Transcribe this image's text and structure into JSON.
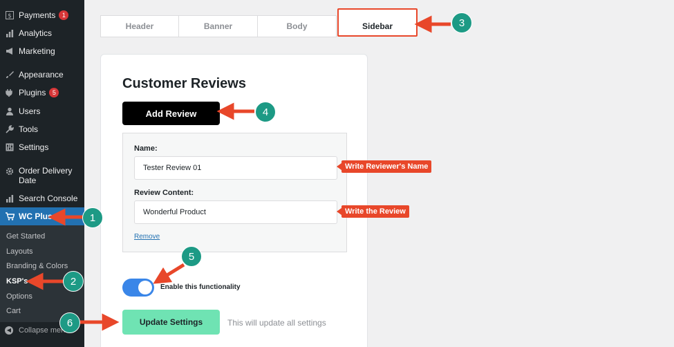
{
  "sidebar": {
    "items": [
      {
        "label": "Payments",
        "icon": "dollar-icon",
        "badge": "1"
      },
      {
        "label": "Analytics",
        "icon": "bar-chart-icon"
      },
      {
        "label": "Marketing",
        "icon": "megaphone-icon"
      },
      {
        "label": "Appearance",
        "icon": "brush-icon"
      },
      {
        "label": "Plugins",
        "icon": "plug-icon",
        "badge": "5"
      },
      {
        "label": "Users",
        "icon": "user-icon"
      },
      {
        "label": "Tools",
        "icon": "wrench-icon"
      },
      {
        "label": "Settings",
        "icon": "sliders-icon"
      },
      {
        "label": "Order Delivery Date",
        "icon": "gear-icon"
      },
      {
        "label": "Search Console",
        "icon": "bar-chart-icon"
      },
      {
        "label": "WC Plus",
        "icon": "cart-icon"
      }
    ],
    "submenu": [
      "Get Started",
      "Layouts",
      "Branding & Colors",
      "KSP's",
      "Options",
      "Cart"
    ],
    "collapse_label": "Collapse menu"
  },
  "tabs": [
    "Header",
    "Banner",
    "Body",
    "Sidebar"
  ],
  "active_tab": "Sidebar",
  "card": {
    "title": "Customer Reviews",
    "add_button": "Add Review",
    "name_label": "Name:",
    "name_value": "Tester Review 01",
    "content_label": "Review Content:",
    "content_value": "Wonderful Product",
    "remove_link": "Remove",
    "toggle_label": "Enable this functionality",
    "update_button": "Update Settings",
    "update_note": "This will update all settings"
  },
  "annotations": {
    "steps": [
      "1",
      "2",
      "3",
      "4",
      "5",
      "6"
    ],
    "callout_name": "Write Reviewer's Name",
    "callout_review": "Write the Review"
  },
  "colors": {
    "accent_red": "#e8472a",
    "step_green": "#1d9a85",
    "wp_blue": "#2271b1",
    "update_green": "#6fe3b3"
  }
}
